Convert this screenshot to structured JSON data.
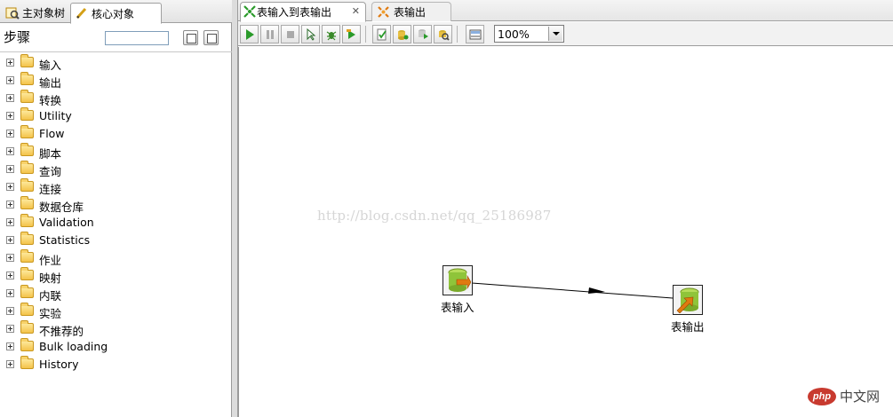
{
  "left_panel": {
    "tabs": [
      {
        "label": "主对象树",
        "icon": "tree-search-icon",
        "active": false
      },
      {
        "label": "核心对象",
        "icon": "pencil-icon",
        "active": true
      }
    ],
    "steps_title": "步骤",
    "search_value": "",
    "tree_items": [
      {
        "label": "输入"
      },
      {
        "label": "输出"
      },
      {
        "label": "转换"
      },
      {
        "label": "Utility"
      },
      {
        "label": "Flow"
      },
      {
        "label": "脚本"
      },
      {
        "label": "查询"
      },
      {
        "label": "连接"
      },
      {
        "label": "数据仓库"
      },
      {
        "label": "Validation"
      },
      {
        "label": "Statistics"
      },
      {
        "label": "作业"
      },
      {
        "label": "映射"
      },
      {
        "label": "内联"
      },
      {
        "label": "实验"
      },
      {
        "label": "不推荐的"
      },
      {
        "label": "Bulk loading"
      },
      {
        "label": "History"
      }
    ]
  },
  "editor": {
    "tabs": [
      {
        "label": "表输入到表输出",
        "icon": "transformation-icon",
        "active": true,
        "closable": true
      },
      {
        "label": "表输出",
        "icon": "transformation-pending-icon",
        "active": false
      }
    ],
    "zoom": "100%",
    "toolbar_buttons": [
      "run-icon",
      "pause-icon",
      "stop-icon",
      "preview-icon",
      "debug-icon",
      "replay-icon",
      "verify-icon",
      "impact-icon",
      "sql-icon",
      "explore-db-icon",
      "show-results-icon"
    ]
  },
  "canvas": {
    "watermark": "http://blog.csdn.net/qq_25186987",
    "steps": [
      {
        "label": "表输入",
        "icon": "table-input-icon"
      },
      {
        "label": "表输出",
        "icon": "table-output-icon"
      }
    ],
    "badge_logo": "php",
    "badge_site": "中文网"
  },
  "colors": {
    "run_green": "#2a9a2a",
    "db_green": "#8fc43a",
    "arrow_orange": "#e07a10",
    "folder_yellow": "#f4c34a",
    "php_red": "#c83a2f"
  }
}
